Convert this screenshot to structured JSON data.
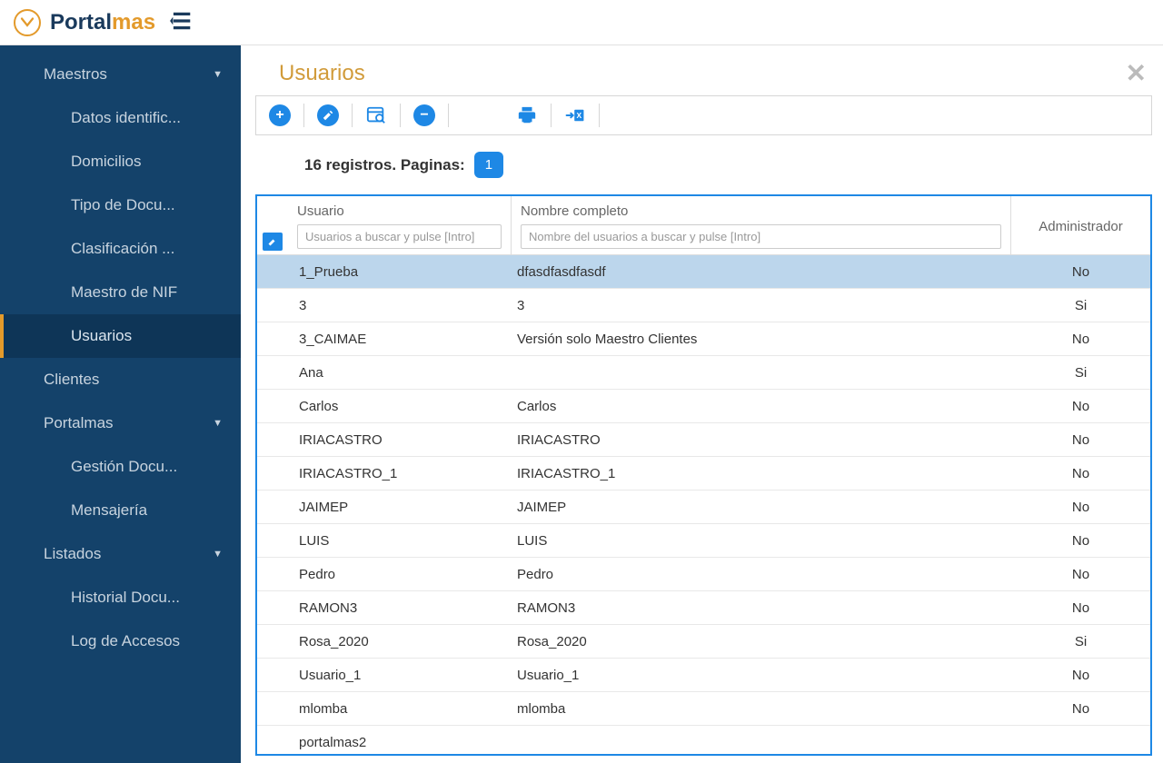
{
  "brand": {
    "part1": "Portal",
    "part2": "mas"
  },
  "sidebar": {
    "groups": [
      {
        "label": "Maestros",
        "expanded": true,
        "items": [
          {
            "label": "Datos identific...",
            "active": false
          },
          {
            "label": "Domicilios",
            "active": false
          },
          {
            "label": "Tipo de Docu...",
            "active": false
          },
          {
            "label": "Clasificación ...",
            "active": false
          },
          {
            "label": "Maestro de NIF",
            "active": false
          },
          {
            "label": "Usuarios",
            "active": true
          }
        ]
      },
      {
        "label": "Clientes",
        "expanded": false,
        "items": []
      },
      {
        "label": "Portalmas",
        "expanded": true,
        "items": [
          {
            "label": "Gestión Docu...",
            "active": false
          },
          {
            "label": "Mensajería",
            "active": false
          }
        ]
      },
      {
        "label": "Listados",
        "expanded": true,
        "items": [
          {
            "label": "Historial Docu...",
            "active": false
          },
          {
            "label": "Log de Accesos",
            "active": false
          }
        ]
      }
    ]
  },
  "page": {
    "title": "Usuarios",
    "pager_text": "16 registros. Paginas:",
    "current_page": "1"
  },
  "grid": {
    "columns": {
      "user": {
        "label": "Usuario",
        "placeholder": "Usuarios a buscar y pulse [Intro]"
      },
      "name": {
        "label": "Nombre completo",
        "placeholder": "Nombre del usuarios a buscar y pulse [Intro]"
      },
      "admin": {
        "label": "Administrador"
      }
    },
    "rows": [
      {
        "user": "1_Prueba",
        "name": "dfasdfasdfasdf",
        "admin": "No",
        "selected": true
      },
      {
        "user": "3",
        "name": "3",
        "admin": "Si"
      },
      {
        "user": "3_CAIMAE",
        "name": "Versión solo Maestro Clientes",
        "admin": "No"
      },
      {
        "user": "Ana",
        "name": "",
        "admin": "Si"
      },
      {
        "user": "Carlos",
        "name": "Carlos",
        "admin": "No"
      },
      {
        "user": "IRIACASTRO",
        "name": "IRIACASTRO",
        "admin": "No"
      },
      {
        "user": "IRIACASTRO_1",
        "name": "IRIACASTRO_1",
        "admin": "No"
      },
      {
        "user": "JAIMEP",
        "name": "JAIMEP",
        "admin": "No"
      },
      {
        "user": "LUIS",
        "name": "LUIS",
        "admin": "No"
      },
      {
        "user": "Pedro",
        "name": "Pedro",
        "admin": "No"
      },
      {
        "user": "RAMON3",
        "name": "RAMON3",
        "admin": "No"
      },
      {
        "user": "Rosa_2020",
        "name": "Rosa_2020",
        "admin": "Si"
      },
      {
        "user": "Usuario_1",
        "name": "Usuario_1",
        "admin": "No"
      },
      {
        "user": "mlomba",
        "name": "mlomba",
        "admin": "No"
      },
      {
        "user": "portalmas2",
        "name": "",
        "admin": ""
      }
    ]
  }
}
